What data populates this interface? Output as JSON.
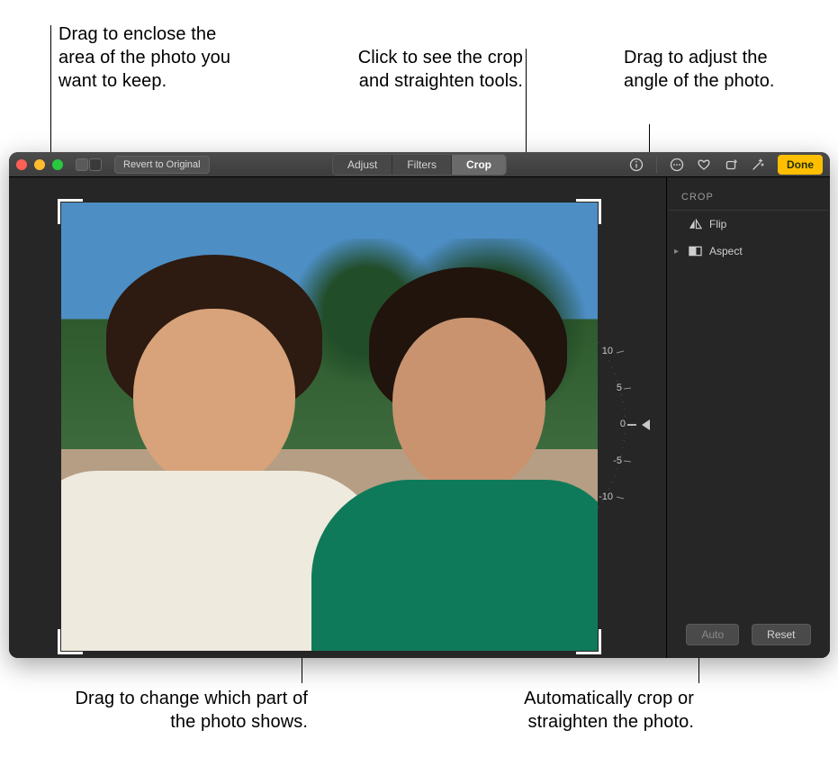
{
  "callouts": {
    "top_left": "Drag to enclose the area of the photo you want to keep.",
    "top_center": "Click to see the crop and straighten tools.",
    "top_right": "Drag to adjust the angle of the photo.",
    "bottom_left": "Drag to change which part of the photo shows.",
    "bottom_right": "Automatically crop or straighten the photo."
  },
  "toolbar": {
    "revert_label": "Revert to Original",
    "done_label": "Done",
    "tabs": {
      "adjust": "Adjust",
      "filters": "Filters",
      "crop": "Crop",
      "active": "crop"
    }
  },
  "sidebar": {
    "heading": "CROP",
    "flip_label": "Flip",
    "aspect_label": "Aspect",
    "auto_label": "Auto",
    "reset_label": "Reset"
  },
  "dial": {
    "ticks": [
      "10",
      "5",
      "0",
      "-5",
      "-10"
    ],
    "value": 0
  }
}
